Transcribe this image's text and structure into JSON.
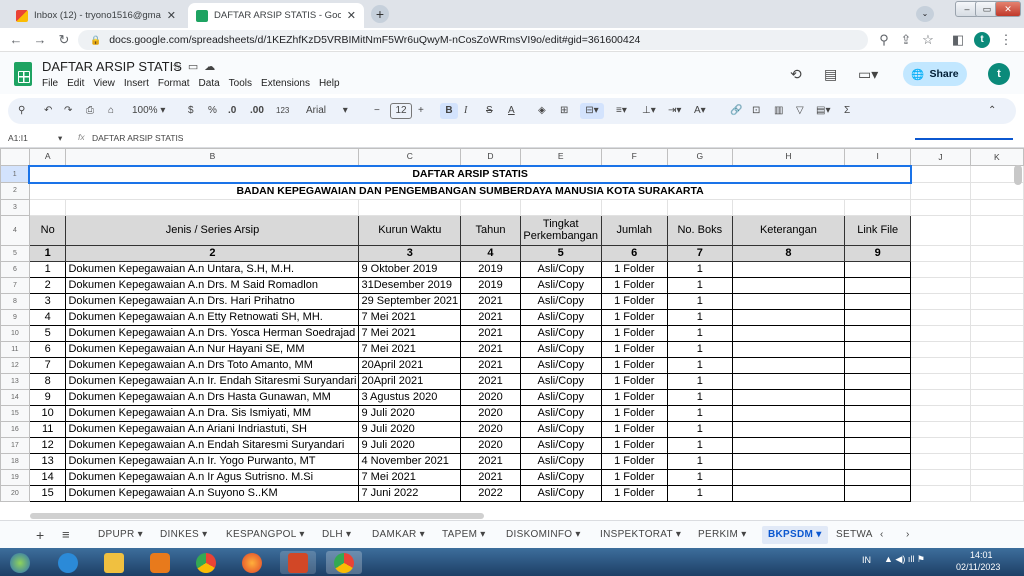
{
  "browser": {
    "tabs": [
      {
        "title": "Inbox (12) - tryono1516@gmail.c",
        "icon": "gmail-icon"
      },
      {
        "title": "DAFTAR ARSIP STATIS - Google S",
        "icon": "sheets-icon"
      }
    ],
    "new_tab": "+",
    "url": "docs.google.com/spreadsheets/d/1KEZhfKzD5VRBIMitNmF5Wr6uQwyM-nCosZoWRmsVI9o/edit#gid=361600424",
    "profile_initial": "t"
  },
  "app": {
    "doc_title": "DAFTAR ARSIP STATIS",
    "menu": [
      "File",
      "Edit",
      "View",
      "Insert",
      "Format",
      "Data",
      "Tools",
      "Extensions",
      "Help"
    ],
    "share_label": "Share",
    "avatar_initial": "t"
  },
  "toolbar": {
    "zoom": "100%",
    "currency": "$",
    "percent": "%",
    "dec_less": ".0",
    "dec_more": ".00",
    "format_123": "123",
    "font": "Arial",
    "font_size": "12",
    "bold": "B",
    "italic": "I",
    "strike": "S",
    "text_color": "A"
  },
  "formula_bar": {
    "cell_ref": "A1:I1",
    "fx": "fx",
    "content": "DAFTAR ARSIP STATIS"
  },
  "columns": [
    "A",
    "B",
    "C",
    "D",
    "E",
    "F",
    "G",
    "H",
    "I",
    "J",
    "K"
  ],
  "sheet": {
    "title": "DAFTAR ARSIP STATIS",
    "subtitle": "BADAN KEPEGAWAIAN DAN PENGEMBANGAN SUMBERDAYA  MANUSIA KOTA SURAKARTA",
    "headers": [
      "No",
      "Jenis / Series Arsip",
      "Kurun Waktu",
      "Tahun",
      "Tingkat Perkembangan",
      "Jumlah",
      "No. Boks",
      "Keterangan",
      "Link File"
    ],
    "header_numbers": [
      "1",
      "2",
      "3",
      "4",
      "5",
      "6",
      "7",
      "8",
      "9"
    ],
    "rows": [
      [
        "1",
        "Dokumen Kepegawaian A.n Untara, S.H, M.H.",
        "9 Oktober 2019",
        "2019",
        "Asli/Copy",
        "1 Folder",
        "1"
      ],
      [
        "2",
        "Dokumen Kepegawaian A.n Drs. M Said Romadlon",
        "31Desember 2019",
        "2019",
        "Asli/Copy",
        "1 Folder",
        "1"
      ],
      [
        "3",
        "Dokumen Kepegawaian A.n Drs. Hari Prihatno",
        "29 September 2021",
        "2021",
        "Asli/Copy",
        "1 Folder",
        "1"
      ],
      [
        "4",
        "Dokumen Kepegawaian A.n Etty Retnowati SH, MH.",
        "7 Mei 2021",
        "2021",
        "Asli/Copy",
        "1 Folder",
        "1"
      ],
      [
        "5",
        "Dokumen Kepegawaian A.n Drs. Yosca Herman Soedrajad",
        "7 Mei 2021",
        "2021",
        "Asli/Copy",
        "1 Folder",
        "1"
      ],
      [
        "6",
        "Dokumen Kepegawaian A.n Nur Hayani SE, MM",
        "7 Mei 2021",
        "2021",
        "Asli/Copy",
        "1 Folder",
        "1"
      ],
      [
        "7",
        "Dokumen Kepegawaian A.n Drs Toto Amanto, MM",
        "20April 2021",
        "2021",
        "Asli/Copy",
        "1 Folder",
        "1"
      ],
      [
        "8",
        "Dokumen Kepegawaian A.n Ir. Endah Sitaresmi Suryandari",
        "20April 2021",
        "2021",
        "Asli/Copy",
        "1 Folder",
        "1"
      ],
      [
        "9",
        "Dokumen Kepegawaian A.n Drs Hasta Gunawan, MM",
        "3 Agustus 2020",
        "2020",
        "Asli/Copy",
        "1 Folder",
        "1"
      ],
      [
        "10",
        "Dokumen Kepegawaian A.n Dra. Sis Ismiyati, MM",
        "9 Juli 2020",
        "2020",
        "Asli/Copy",
        "1 Folder",
        "1"
      ],
      [
        "11",
        "Dokumen Kepegawaian A.n Ariani Indriastuti, SH",
        "9 Juli 2020",
        "2020",
        "Asli/Copy",
        "1 Folder",
        "1"
      ],
      [
        "12",
        "Dokumen Kepegawaian A.n Endah Sitaresmi Suryandari",
        "9 Juli 2020",
        "2020",
        "Asli/Copy",
        "1 Folder",
        "1"
      ],
      [
        "13",
        "Dokumen Kepegawaian A.n Ir. Yogo Purwanto, MT",
        "4 November 2021",
        "2021",
        "Asli/Copy",
        "1 Folder",
        "1"
      ],
      [
        "14",
        "Dokumen Kepegawaian A.n Ir Agus Sutrisno. M.Si",
        "7 Mei 2021",
        "2021",
        "Asli/Copy",
        "1 Folder",
        "1"
      ],
      [
        "15",
        "Dokumen Kepegawaian A.n Suyono S..KM",
        "7 Juni 2022",
        "2022",
        "Asli/Copy",
        "1 Folder",
        "1"
      ]
    ]
  },
  "sheet_tabs": [
    "DPUPR",
    "DINKES",
    "KESPANGPOL",
    "DLH",
    "DAMKAR",
    "TAPEM",
    "DISKOMINFO",
    "INSPEKTORAT",
    "PERKIM",
    "BKPSDM",
    "SETWA"
  ],
  "active_sheet_tab": "BKPSDM",
  "taskbar": {
    "lang": "IN",
    "time": "14:01",
    "date": "02/11/2023"
  }
}
